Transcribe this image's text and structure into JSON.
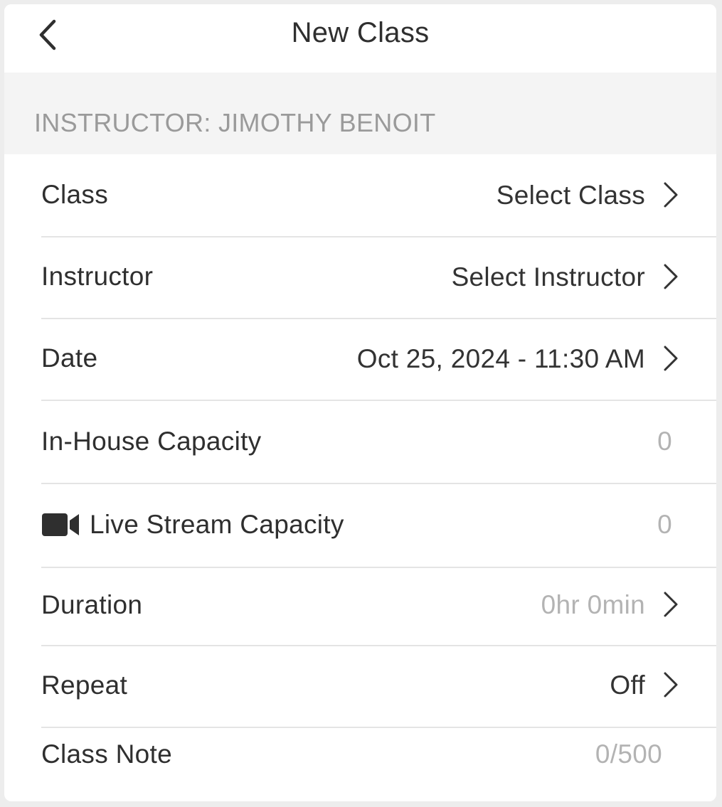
{
  "navbar": {
    "title": "New Class",
    "back_icon": "chevron-left-icon"
  },
  "section": {
    "header": "INSTRUCTOR: JIMOTHY BENOIT"
  },
  "rows": {
    "class": {
      "label": "Class",
      "value": "Select Class"
    },
    "instructor": {
      "label": "Instructor",
      "value": "Select Instructor"
    },
    "date": {
      "label": "Date",
      "value": "Oct 25, 2024 - 11:30 AM"
    },
    "in_house": {
      "label": "In-House Capacity",
      "value": "0"
    },
    "live_stream": {
      "label": "Live Stream Capacity",
      "value": "0",
      "icon": "video-camera-icon"
    },
    "duration": {
      "label": "Duration",
      "value": "0hr 0min"
    },
    "repeat": {
      "label": "Repeat",
      "value": "Off"
    },
    "class_note": {
      "label": "Class Note",
      "value": "0/500"
    }
  },
  "colors": {
    "text": "#2f2f2f",
    "muted": "#b3b3b3",
    "section_bg": "#f4f4f4",
    "section_text": "#9a9a9a",
    "divider": "#e4e4e4"
  }
}
